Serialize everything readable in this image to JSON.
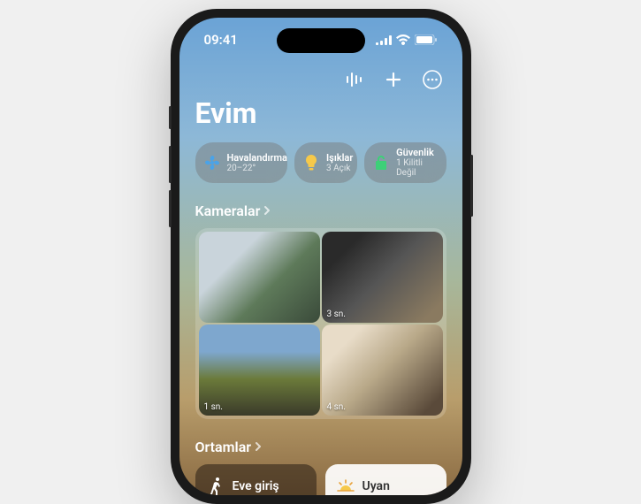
{
  "status": {
    "time": "09:41"
  },
  "header": {
    "title": "Evim"
  },
  "chips": [
    {
      "title": "Havalandırma",
      "sub": "20–22°",
      "icon": "fan",
      "color": "#4aa3e8"
    },
    {
      "title": "Işıklar",
      "sub": "3 Açık",
      "icon": "bulb",
      "color": "#f6c94a"
    },
    {
      "title": "Güvenlik",
      "sub": "1 Kilitli Değil",
      "icon": "lock",
      "color": "#3dd078"
    }
  ],
  "sections": {
    "cameras": "Kameralar",
    "scenes": "Ortamlar"
  },
  "cameras": [
    {
      "badge": ""
    },
    {
      "badge": "3 sn."
    },
    {
      "badge": "1 sn."
    },
    {
      "badge": "4 sn."
    }
  ],
  "scenes": [
    {
      "label": "Eve giriş",
      "icon": "walk",
      "variant": "dark"
    },
    {
      "label": "Uyan",
      "icon": "sunrise",
      "variant": "light"
    }
  ]
}
